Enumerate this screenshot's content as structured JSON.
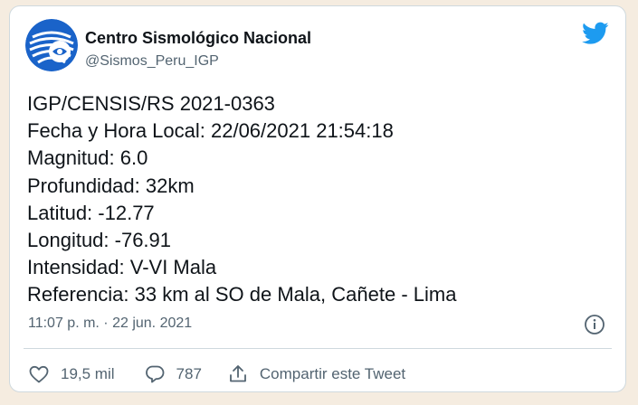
{
  "tweet": {
    "author_name": "Centro Sismológico Nacional",
    "author_handle": "@Sismos_Peru_IGP",
    "lines": [
      "IGP/CENSIS/RS 2021-0363",
      "Fecha y Hora Local: 22/06/2021 21:54:18",
      "Magnitud: 6.0",
      "Profundidad: 32km",
      "Latitud: -12.77",
      "Longitud: -76.91",
      "Intensidad: V-VI Mala",
      "Referencia: 33 km al SO de Mala, Cañete - Lima"
    ],
    "timestamp": "11:07 p. m. · 22 jun. 2021"
  },
  "actions": {
    "likes": "19,5 mil",
    "replies": "787",
    "share_label": "Compartir este Tweet"
  },
  "icons": {
    "brand": "twitter-bird-icon",
    "info": "info-icon",
    "like": "heart-icon",
    "reply": "reply-bubble-icon",
    "share": "share-icon"
  },
  "colors": {
    "twitter_blue": "#1d9bf0",
    "avatar_blue": "#1a63c9",
    "secondary_text": "#536471",
    "page_background": "#f5ece0"
  }
}
